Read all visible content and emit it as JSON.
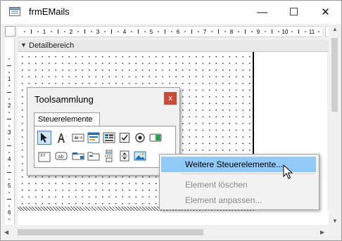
{
  "window": {
    "title": "frmEMails",
    "controls": {
      "minimize": "—",
      "maximize": "☐",
      "close": "✕"
    }
  },
  "ruler": {
    "horizontal_numbers": [
      "1",
      "2",
      "3",
      "4",
      "5",
      "6",
      "7",
      "8",
      "9",
      "10",
      "11"
    ],
    "vertical_numbers": [
      "1",
      "2",
      "3",
      "4",
      "5",
      "6"
    ]
  },
  "section": {
    "label": "Detailbereich"
  },
  "toolbox": {
    "title": "Toolsammlung",
    "close_label": "x",
    "tab_label": "Steuerelemente",
    "row1_tools": [
      "pointer-icon",
      "label-icon",
      "textbox-icon",
      "form-icon",
      "listbox-icon",
      "checkbox-icon",
      "option-button-icon",
      "toggle-icon"
    ],
    "row2_tools": [
      "combo-icon",
      "button-icon",
      "tab-control-icon",
      "subform-icon",
      "page-break-icon",
      "spin-icon",
      "image-icon"
    ]
  },
  "context_menu": {
    "items": [
      {
        "label": "Weitere Steuerelemente...",
        "state": "highlighted"
      },
      {
        "label": "Element löschen",
        "state": "disabled"
      },
      {
        "label": "Element anpassen...",
        "state": "disabled"
      }
    ]
  },
  "colors": {
    "highlight": "#91c9f7",
    "close_red": "#c84b3c",
    "disabled_text": "#8a8a8a"
  }
}
